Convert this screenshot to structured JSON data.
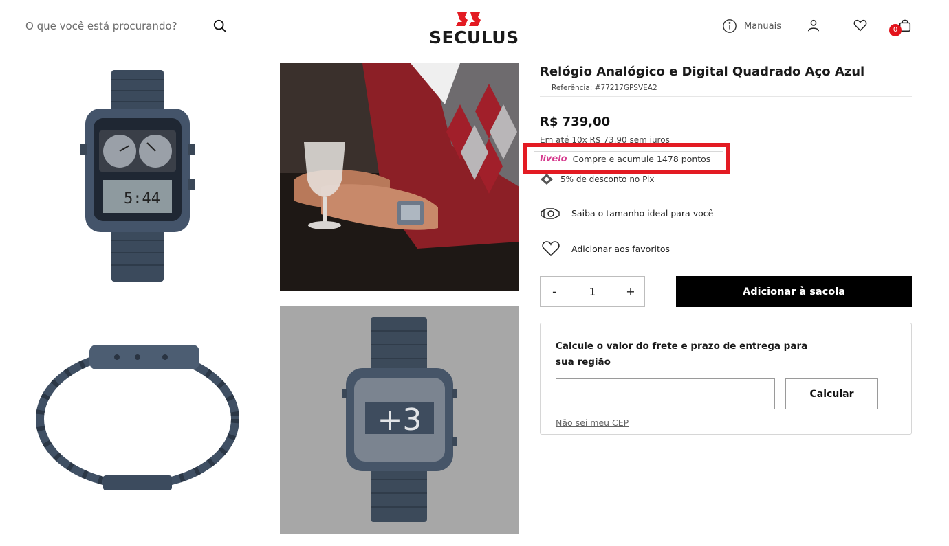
{
  "header": {
    "search_placeholder": "O que você está procurando?",
    "logo_text": "SECULUS",
    "manuals_label": "Manuais",
    "cart_count": "0"
  },
  "gallery": {
    "more_images_label": "+3"
  },
  "product": {
    "title": "Relógio Analógico e Digital Quadrado Aço Azul",
    "reference": "Referência: #77217GPSVEA2",
    "price": "R$ 739,00",
    "installments": "Em até 10x R$ 73,90 sem juros",
    "livelo_logo": "livelo",
    "livelo_text": "Compre e acumule 1478 pontos",
    "pix_text": "5% de desconto no Pix",
    "size_guide_label": "Saiba o tamanho ideal para você",
    "favorites_label": "Adicionar aos favoritos",
    "quantity": "1",
    "qty_minus": "-",
    "qty_plus": "+",
    "add_to_bag_label": "Adicionar à sacola"
  },
  "shipping": {
    "title": "Calcule o valor do frete e prazo de entrega para sua região",
    "cep_value": "",
    "calculate_label": "Calcular",
    "unknown_cep_label": "Não sei meu CEP"
  },
  "colors": {
    "brand_red": "#e31b23",
    "livelo_pink": "#d63b8e",
    "watch_blue": "#3f4f62"
  }
}
